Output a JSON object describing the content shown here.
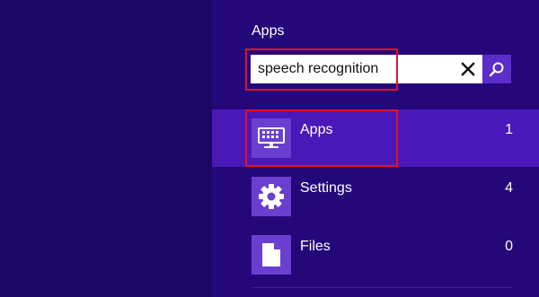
{
  "search_pane": {
    "title": "Apps",
    "search": {
      "value": "speech recognition",
      "clear_icon": "close-icon",
      "submit_icon": "search-icon"
    },
    "results": [
      {
        "label": "Apps",
        "count": "1",
        "icon": "keyboard-monitor-icon",
        "selected": true
      },
      {
        "label": "Settings",
        "count": "4",
        "icon": "gear-icon",
        "selected": false
      },
      {
        "label": "Files",
        "count": "0",
        "icon": "document-icon",
        "selected": false
      }
    ]
  },
  "colors": {
    "background": "#1c0766",
    "pane": "#24087a",
    "selected_row": "#4a17b8",
    "tile": "#6a3fcf",
    "search_button": "#5b2dc9",
    "highlight": "#e0122a"
  }
}
